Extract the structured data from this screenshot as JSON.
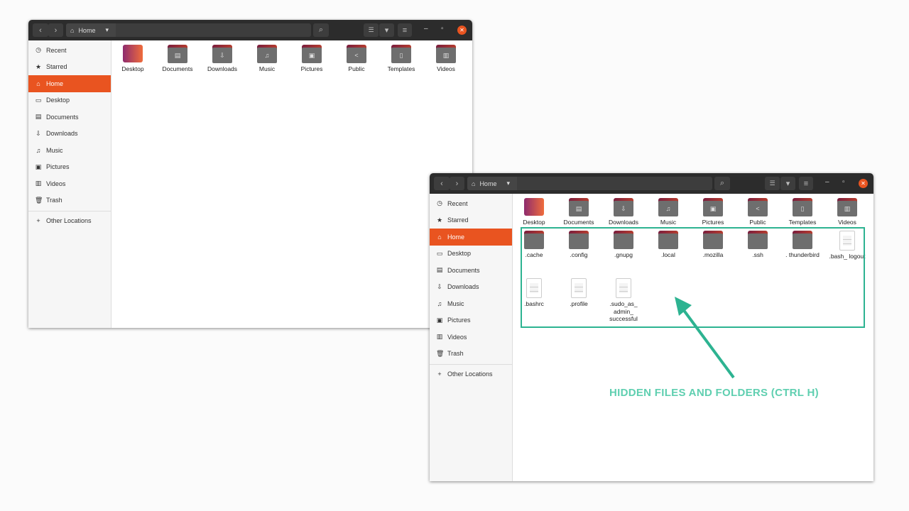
{
  "windows": [
    {
      "location": "Home",
      "sidebar": [
        {
          "icon": "◷",
          "label": "Recent"
        },
        {
          "icon": "★",
          "label": "Starred"
        },
        {
          "icon": "⌂",
          "label": "Home",
          "active": true
        },
        {
          "icon": "▭",
          "label": "Desktop"
        },
        {
          "icon": "▤",
          "label": "Documents"
        },
        {
          "icon": "⇩",
          "label": "Downloads"
        },
        {
          "icon": "♫",
          "label": "Music"
        },
        {
          "icon": "▣",
          "label": "Pictures"
        },
        {
          "icon": "▥",
          "label": "Videos"
        },
        {
          "icon": "🗑",
          "label": "Trash"
        }
      ],
      "other_locations": "Other Locations",
      "items": [
        {
          "type": "desktop",
          "label": "Desktop"
        },
        {
          "type": "folder",
          "glyph": "▤",
          "label": "Documents"
        },
        {
          "type": "folder",
          "glyph": "⇩",
          "label": "Downloads"
        },
        {
          "type": "folder",
          "glyph": "♫",
          "label": "Music"
        },
        {
          "type": "folder",
          "glyph": "▣",
          "label": "Pictures"
        },
        {
          "type": "folder",
          "glyph": "<",
          "label": "Public"
        },
        {
          "type": "folder",
          "glyph": "▯",
          "label": "Templates"
        },
        {
          "type": "folder",
          "glyph": "▥",
          "label": "Videos"
        }
      ]
    },
    {
      "location": "Home",
      "sidebar": [
        {
          "icon": "◷",
          "label": "Recent"
        },
        {
          "icon": "★",
          "label": "Starred"
        },
        {
          "icon": "⌂",
          "label": "Home",
          "active": true
        },
        {
          "icon": "▭",
          "label": "Desktop"
        },
        {
          "icon": "▤",
          "label": "Documents"
        },
        {
          "icon": "⇩",
          "label": "Downloads"
        },
        {
          "icon": "♫",
          "label": "Music"
        },
        {
          "icon": "▣",
          "label": "Pictures"
        },
        {
          "icon": "▥",
          "label": "Videos"
        },
        {
          "icon": "🗑",
          "label": "Trash"
        }
      ],
      "other_locations": "Other Locations",
      "items": [
        {
          "type": "desktop",
          "label": "Desktop"
        },
        {
          "type": "folder",
          "glyph": "▤",
          "label": "Documents"
        },
        {
          "type": "folder",
          "glyph": "⇩",
          "label": "Downloads"
        },
        {
          "type": "folder",
          "glyph": "♫",
          "label": "Music"
        },
        {
          "type": "folder",
          "glyph": "▣",
          "label": "Pictures"
        },
        {
          "type": "folder",
          "glyph": "<",
          "label": "Public"
        },
        {
          "type": "folder",
          "glyph": "▯",
          "label": "Templates"
        },
        {
          "type": "folder",
          "glyph": "▥",
          "label": "Videos"
        },
        {
          "type": "folder",
          "glyph": "",
          "label": ".cache"
        },
        {
          "type": "folder",
          "glyph": "",
          "label": ".config"
        },
        {
          "type": "folder",
          "glyph": "",
          "label": ".gnupg"
        },
        {
          "type": "folder",
          "glyph": "",
          "label": ".local"
        },
        {
          "type": "folder",
          "glyph": "",
          "label": ".mozilla"
        },
        {
          "type": "folder",
          "glyph": "",
          "label": ".ssh"
        },
        {
          "type": "folder",
          "glyph": "",
          "label": ". thunderbird"
        },
        {
          "type": "file",
          "label": ".bash_ logout"
        },
        {
          "type": "file",
          "label": ".bashrc"
        },
        {
          "type": "file",
          "label": ".profile"
        },
        {
          "type": "file",
          "label": ".sudo_as_ admin_ successful"
        }
      ]
    }
  ],
  "annotation": {
    "text": "HIDDEN FILES AND FOLDERS (CTRL H)",
    "color": "#2db391"
  }
}
